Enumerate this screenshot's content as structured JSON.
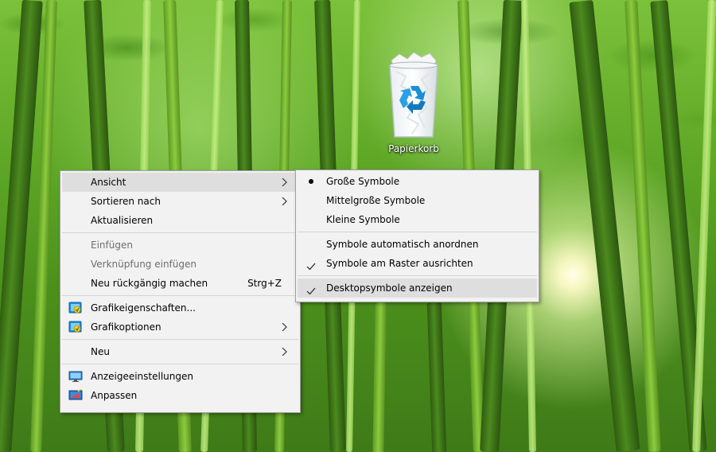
{
  "desktop": {
    "recycle_bin_label": "Papierkorb"
  },
  "context_menu": {
    "items": [
      {
        "label": "Ansicht"
      },
      {
        "label": "Sortieren nach"
      },
      {
        "label": "Aktualisieren"
      },
      {
        "label": "Einfügen"
      },
      {
        "label": "Verknüpfung einfügen"
      },
      {
        "label": "Neu rückgängig machen",
        "shortcut": "Strg+Z"
      },
      {
        "label": "Grafikeigenschaften..."
      },
      {
        "label": "Grafikoptionen"
      },
      {
        "label": "Neu"
      },
      {
        "label": "Anzeigeeinstellungen"
      },
      {
        "label": "Anpassen"
      }
    ]
  },
  "view_submenu": {
    "items": [
      {
        "label": "Große Symbole",
        "selected": true
      },
      {
        "label": "Mittelgroße Symbole"
      },
      {
        "label": "Kleine Symbole"
      },
      {
        "label": "Symbole automatisch anordnen",
        "checked": false
      },
      {
        "label": "Symbole am Raster ausrichten",
        "checked": true
      },
      {
        "label": "Desktopsymbole anzeigen",
        "checked": true
      }
    ]
  },
  "icons": {
    "recycle_bin": "recycle-bin-icon",
    "graphics": "intel-graphics-icon",
    "display": "display-settings-icon",
    "personalize": "personalize-icon",
    "submenu_arrow": "chevron-right-icon",
    "radio": "radio-bullet-icon",
    "check": "checkmark-icon"
  },
  "colors": {
    "menu_bg": "#f2f2f2",
    "menu_highlight": "#dedede",
    "disabled_text": "#6d6d6d",
    "menu_border": "#a0a0a0"
  }
}
